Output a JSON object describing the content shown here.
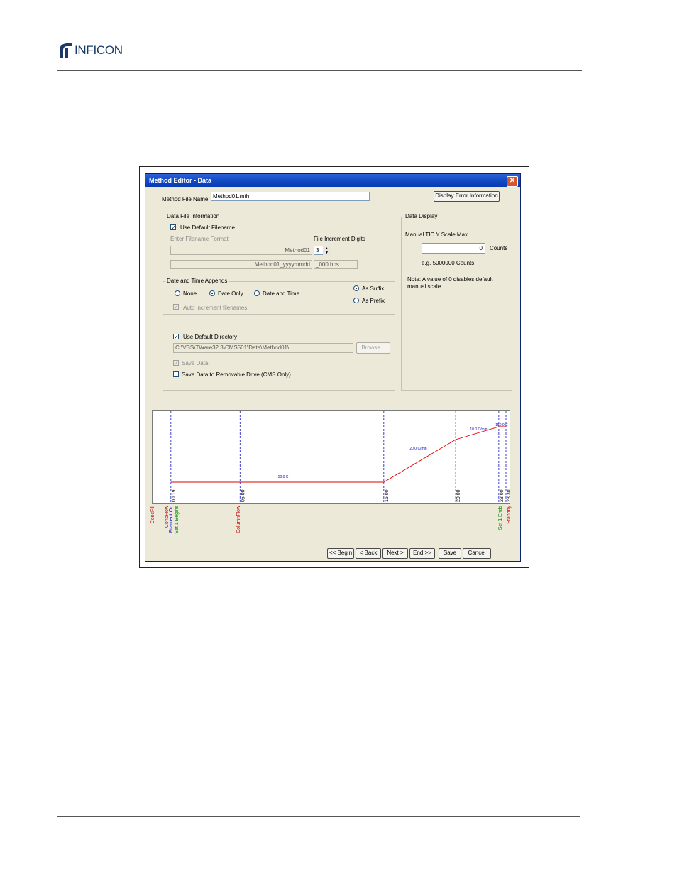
{
  "header": {
    "brand": "INFICON"
  },
  "window": {
    "title": "Method Editor - Data",
    "close_glyph": "✕",
    "method_file_label": "Method File Name:",
    "method_file_value": "Method01.mth",
    "display_error_button": "Display Error Information",
    "data_file_info": {
      "title": "Data File Information",
      "use_default_filename": "Use Default Filename",
      "use_default_filename_checked": true,
      "enter_filename_format": "Enter Filename Format",
      "file_increment_digits": "File Increment Digits",
      "filename_format_value": "Method01",
      "increment_digits_value": "3",
      "preview_name": "Method01_yyyymmdd",
      "preview_suffix": "_000.hps"
    },
    "date_time": {
      "title": "Date and Time Appends",
      "options": [
        "None",
        "Date Only",
        "Date and Time"
      ],
      "selected": "Date Only",
      "position_options": [
        "As Suffix",
        "As Prefix"
      ],
      "position_selected": "As Suffix",
      "auto_increment": "Auto increment filenames",
      "auto_increment_checked": true
    },
    "directory": {
      "use_default_directory": "Use Default Directory",
      "use_default_directory_checked": true,
      "path": "C:\\VSS\\TWare32.3\\CMS501\\Data\\Method01\\",
      "browse_button": "Browse...",
      "save_data": "Save Data",
      "save_data_checked": true,
      "save_removable": "Save Data to Removable Drive (CMS Only)",
      "save_removable_checked": false
    },
    "data_display": {
      "title": "Data Display",
      "manual_tic_label": "Manual TIC Y Scale Max",
      "manual_tic_value": "0",
      "counts_unit": "Counts",
      "example": "e.g. 5000000  Counts",
      "note": "Note:  A value of 0 disables default manual scale"
    },
    "buttons": {
      "begin": "<< Begin",
      "back": "< Back",
      "next": "Next >",
      "end": "End >>",
      "save": "Save",
      "cancel": "Cancel"
    }
  },
  "chart_data": {
    "type": "line",
    "x_range": [
      0,
      23.5
    ],
    "y_range": [
      0,
      13
    ],
    "series": [
      {
        "x": [
          0.19,
          5.0,
          15.0,
          20.0,
          23.0,
          23.5
        ],
        "y": [
          3.0,
          3.0,
          3.0,
          9.0,
          10.8,
          10.8
        ]
      }
    ],
    "time_ticks": [
      {
        "x": 0.19,
        "label": "00:19"
      },
      {
        "x": 5.0,
        "label": "05:00"
      },
      {
        "x": 15.0,
        "label": "15:00"
      },
      {
        "x": 20.0,
        "label": "20:00"
      },
      {
        "x": 23.0,
        "label": "23:00"
      },
      {
        "x": 23.5,
        "label": "23:30"
      }
    ],
    "segment_labels": [
      {
        "x": 8.0,
        "y": 3.6,
        "text": "50.0 C"
      },
      {
        "x": 17.4,
        "y": 7.6,
        "text": "20.0 C/min"
      },
      {
        "x": 21.6,
        "y": 10.3,
        "text": "10.0 C/min"
      },
      {
        "x": 23.2,
        "y": 10.9,
        "text": "150.0 C"
      }
    ],
    "events": [
      {
        "x": -1.0,
        "text": "ConcFill",
        "color": "#cc0000"
      },
      {
        "x": 0.0,
        "text": "ConcFlow",
        "color": "#cc0000"
      },
      {
        "x": 0.3,
        "text": "Filament On",
        "color": "#0000cc"
      },
      {
        "x": 0.7,
        "text": "Set 1 Begins",
        "color": "#008800"
      },
      {
        "x": 5.0,
        "text": "ColumnFlow",
        "color": "#cc0000"
      },
      {
        "x": 23.2,
        "text": "Set 1 Ends",
        "color": "#008800"
      },
      {
        "x": 23.8,
        "text": "Standby",
        "color": "#cc0000"
      }
    ],
    "colors": {
      "line": "#e00000",
      "markers": "#1010c0"
    }
  }
}
